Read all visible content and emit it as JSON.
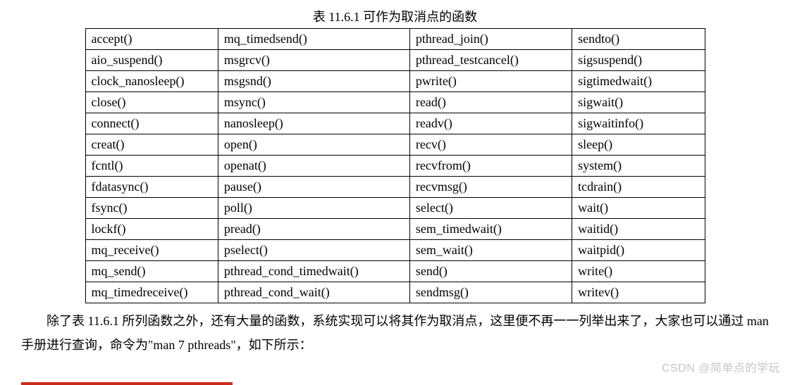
{
  "top_left_fragment": " ",
  "top_right_fragment": " ",
  "caption": "表 11.6.1 可作为取消点的函数",
  "rows": [
    [
      "accept()",
      "mq_timedsend()",
      "pthread_join()",
      "sendto()"
    ],
    [
      "aio_suspend()",
      "msgrcv()",
      "pthread_testcancel()",
      "sigsuspend()"
    ],
    [
      "clock_nanosleep()",
      "msgsnd()",
      "pwrite()",
      "sigtimedwait()"
    ],
    [
      "close()",
      "msync()",
      "read()",
      "sigwait()"
    ],
    [
      "connect()",
      "nanosleep()",
      "readv()",
      "sigwaitinfo()"
    ],
    [
      "creat()",
      "open()",
      "recv()",
      "sleep()"
    ],
    [
      "fcntl()",
      "openat()",
      "recvfrom()",
      "system()"
    ],
    [
      "fdatasync()",
      "pause()",
      "recvmsg()",
      "tcdrain()"
    ],
    [
      "fsync()",
      "poll()",
      "select()",
      "wait()"
    ],
    [
      "lockf()",
      "pread()",
      "sem_timedwait()",
      "waitid()"
    ],
    [
      "mq_receive()",
      "pselect()",
      "sem_wait()",
      "waitpid()"
    ],
    [
      "mq_send()",
      "pthread_cond_timedwait()",
      "send()",
      "write()"
    ],
    [
      "mq_timedreceive()",
      "pthread_cond_wait()",
      "sendmsg()",
      "writev()"
    ]
  ],
  "paragraph": "除了表 11.6.1 所列函数之外，还有大量的函数，系统实现可以将其作为取消点，这里便不再一一列举出来了，大家也可以通过 man 手册进行查询，命令为\"man 7 pthreads\"，如下所示：",
  "watermark": "CSDN @简单点的学玩"
}
